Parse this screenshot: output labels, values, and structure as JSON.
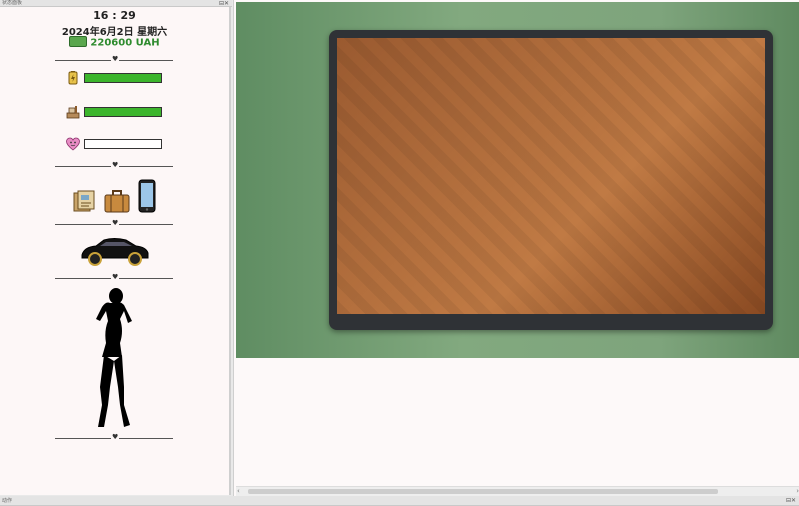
{
  "sidebar_window": {
    "title": "状态面板",
    "controls": "⊟✕"
  },
  "bottom_window": {
    "title": "动作",
    "controls": "⊟✕"
  },
  "hud": {
    "time": "16 : 29",
    "date": "2024年6月2日 星期六",
    "money": "220600 UAH"
  },
  "stats": [
    {
      "icon": "battery-icon",
      "value": 1.0
    },
    {
      "icon": "food-icon",
      "value": 1.0
    },
    {
      "icon": "heart-face-icon",
      "value": 0.0
    }
  ],
  "inventory": [
    "documents-icon",
    "suitcase-icon",
    "smartphone-icon"
  ],
  "colors": {
    "bar_fill": "#3cb52c",
    "money": "#2e8b2e",
    "accent": "#7ea47c"
  }
}
